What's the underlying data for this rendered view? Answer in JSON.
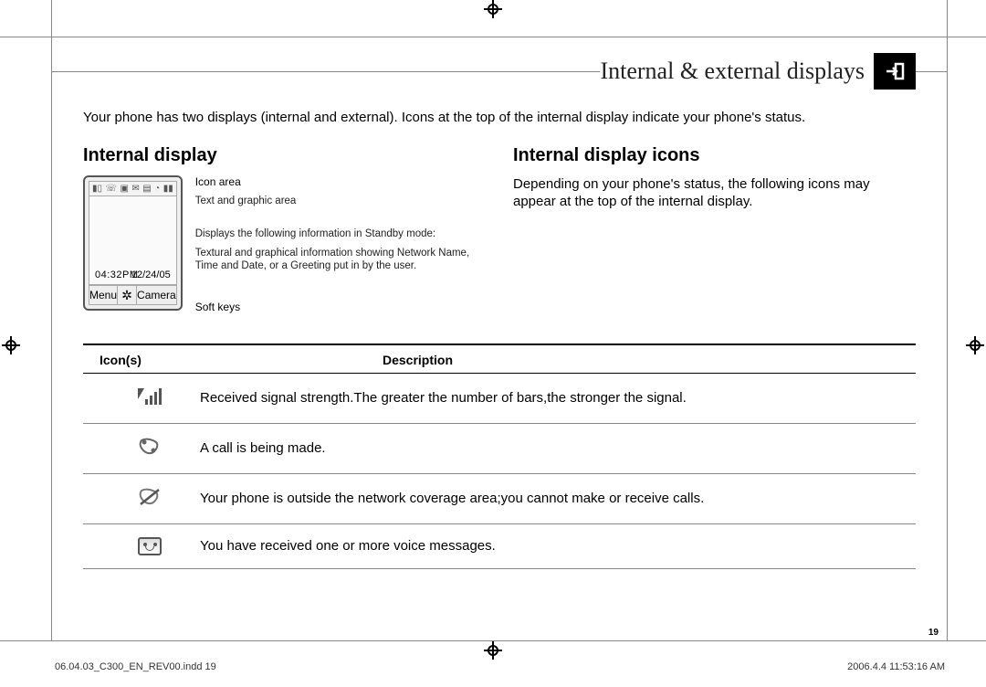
{
  "header": {
    "title": "Internal & external displays"
  },
  "intro": "Your phone has two displays (internal and external). Icons at the top of the internal display indicate your phone's status.",
  "left": {
    "heading": "Internal display",
    "phone": {
      "time": "04:32PM",
      "date": "12/24/05",
      "soft_left": "Menu",
      "soft_center": "✲",
      "soft_right": "Camera"
    },
    "annot": {
      "a1": "Icon area",
      "a2": "Text and graphic area",
      "a3": "Displays the following information in Standby mode:",
      "a4": "Textural and graphical information showing Network Name, Time and Date, or a Greeting put in by the user.",
      "a5": "Soft keys"
    }
  },
  "right": {
    "heading": "Internal display icons",
    "para": "Depending on your phone's status, the following icons may appear at the top of the internal display."
  },
  "table": {
    "col1": "Icon(s)",
    "col2": "Description",
    "rows": {
      "r1": "Received signal strength.The greater the number of bars,the stronger the signal.",
      "r2": "A call is being made.",
      "r3": "Your phone is outside the network coverage area;you cannot make or receive calls.",
      "r4": "You have received one or more voice messages."
    }
  },
  "page_num": "19",
  "footer": {
    "left": "06.04.03_C300_EN_REV00.indd   19",
    "right": "2006.4.4   11:53:16 AM"
  }
}
